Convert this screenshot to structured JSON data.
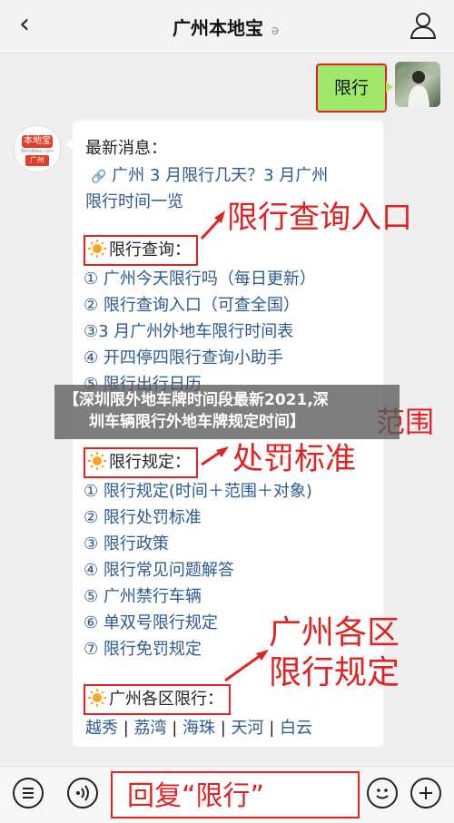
{
  "nav": {
    "title": "广州本地宝",
    "back_icon": "‹"
  },
  "chat": {
    "user_message": "限行",
    "bot": {
      "logo_top": "本地宝",
      "logo_mid": "Bendibao.com",
      "logo_bottom": "广州",
      "card_heading": "最新消息：",
      "news_icon": "🔗",
      "news_line1": "广州 3 月限行几天？3 月广州",
      "news_line2": "限行时间一览",
      "section1": {
        "title": "限行查询：",
        "items": [
          "① 广州今天限行吗（每日更新）",
          "② 限行查询入口（可查全国）",
          "③3 月广州外地车限行时间表",
          "④ 开四停四限行查询小助手",
          "⑤ 限行出行日历"
        ]
      },
      "section2": {
        "title": "限行规定：",
        "items": [
          "① 限行规定(时间＋范围＋对象)",
          "② 限行处罚标准",
          "③ 限行政策",
          "④ 限行常见问题解答",
          "⑤ 广州禁行车辆",
          "⑥ 单双号限行规定",
          "⑦ 限行免罚规定"
        ]
      },
      "section3": {
        "title": "广州各区限行：",
        "districts": [
          "越秀",
          "荔湾",
          "海珠",
          "天河",
          "白云"
        ]
      }
    }
  },
  "annotations": {
    "query_entry": "限行查询入口",
    "scope": "范围",
    "penalty": "处罚标准",
    "district_line1": "广州各区",
    "district_line2": "限行规定"
  },
  "banner": {
    "line1": "【深圳限外地车牌时间段最新2021,深",
    "line2": "圳车辆限行外地车牌规定时间】"
  },
  "reply_hint": "回复“限行”",
  "colors": {
    "accent_red": "#e02222",
    "bubble_green": "#9fe86b",
    "link_blue": "#2b5a8f"
  }
}
